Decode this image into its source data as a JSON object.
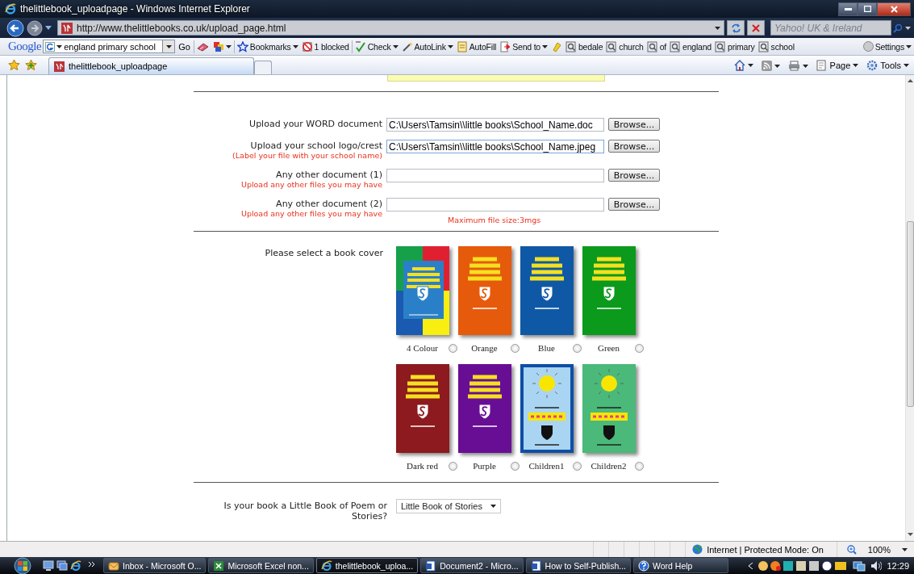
{
  "window": {
    "title": "thelittlebook_uploadpage - Windows Internet Explorer"
  },
  "address_bar": {
    "url": "http://www.thelittlebooks.co.uk/upload_page.html",
    "search_placeholder": "Yahoo! UK & Ireland"
  },
  "google_toolbar": {
    "logo": "Google",
    "query": "england primary school",
    "go": "Go",
    "items": [
      {
        "kind": "bookmarks",
        "label": "Bookmarks",
        "dropdown": true
      },
      {
        "kind": "blocked",
        "label": "1 blocked",
        "dropdown": false
      },
      {
        "kind": "check",
        "label": "Check",
        "dropdown": true
      },
      {
        "kind": "autolink",
        "label": "AutoLink",
        "dropdown": true
      },
      {
        "kind": "autofill",
        "label": "AutoFill",
        "dropdown": false
      },
      {
        "kind": "sendto",
        "label": "Send to",
        "dropdown": true
      },
      {
        "kind": "highlight",
        "dropdown": false
      },
      {
        "kind": "term",
        "label": "bedale",
        "dropdown": false
      },
      {
        "kind": "term",
        "label": "church",
        "dropdown": false
      },
      {
        "kind": "term",
        "label": "of",
        "dropdown": false
      },
      {
        "kind": "term",
        "label": "england",
        "dropdown": false
      },
      {
        "kind": "term",
        "label": "primary",
        "dropdown": false
      },
      {
        "kind": "term",
        "label": "school",
        "dropdown": false
      }
    ],
    "settings": "Settings"
  },
  "tabs": [
    {
      "label": "thelittlebook_uploadpage",
      "selected": true
    }
  ],
  "command_bar": [
    "Page",
    "Tools"
  ],
  "form": {
    "uploads": [
      {
        "label": "Upload your WORD document",
        "value": "C:\\Users\\Tamsin\\\\little books\\School_Name.doc",
        "focused": false,
        "button": "Browse..."
      },
      {
        "label": "Upload your school logo/crest",
        "hint": "(Label your file with your school name)",
        "value": "C:\\Users\\Tamsin\\\\little books\\School_Name.jpeg",
        "focused": true,
        "button": "Browse..."
      },
      {
        "label": "Any other document (1)",
        "hint": "Upload any other files you may have",
        "focused": false,
        "button": "Browse..."
      },
      {
        "label": "Any other document (2)",
        "hint": "Upload any other files you may have",
        "focused": false,
        "button": "Browse..."
      }
    ],
    "max_size_note": "Maximum file size:3mgs",
    "cover_prompt": "Please select a book cover",
    "covers": [
      {
        "kind": "four-colour",
        "name": "4 Colour",
        "color": "#2a80c8",
        "selected": false
      },
      {
        "kind": "plain",
        "name": "Orange",
        "color": "#e65a0c",
        "selected": false
      },
      {
        "kind": "plain",
        "name": "Blue",
        "color": "#0f58a6",
        "selected": false
      },
      {
        "kind": "plain",
        "name": "Green",
        "color": "#0b9a1c",
        "selected": false
      },
      {
        "kind": "plain",
        "name": "Dark red",
        "color": "#8c1a1e",
        "selected": false
      },
      {
        "kind": "plain",
        "name": "Purple",
        "color": "#680e94",
        "selected": false
      },
      {
        "kind": "children",
        "name": "Children1",
        "color": "#a9d5f2",
        "selected": false
      },
      {
        "kind": "children",
        "name": "Children2",
        "color": "#4ab97a",
        "selected": false
      }
    ],
    "question": "Is your book a Little Book of Poem or Stories?",
    "book_type": "Little Book of Stories"
  },
  "status_bar": {
    "zone": "Internet | Protected Mode: On",
    "zoom": "100%"
  },
  "taskbar": {
    "items": [
      {
        "kind": "mail",
        "label": "Inbox - Microsoft O...",
        "selected": false
      },
      {
        "kind": "excel",
        "label": "Microsoft Excel non...",
        "selected": false
      },
      {
        "kind": "ie",
        "label": "thelittlebook_uploa...",
        "selected": true
      },
      {
        "kind": "word",
        "label": "Document2 - Micro...",
        "selected": false
      },
      {
        "kind": "word",
        "label": "How to Self-Publish...",
        "selected": false
      },
      {
        "kind": "help",
        "label": "Word Help",
        "selected": false
      }
    ],
    "clock": "12:29"
  }
}
